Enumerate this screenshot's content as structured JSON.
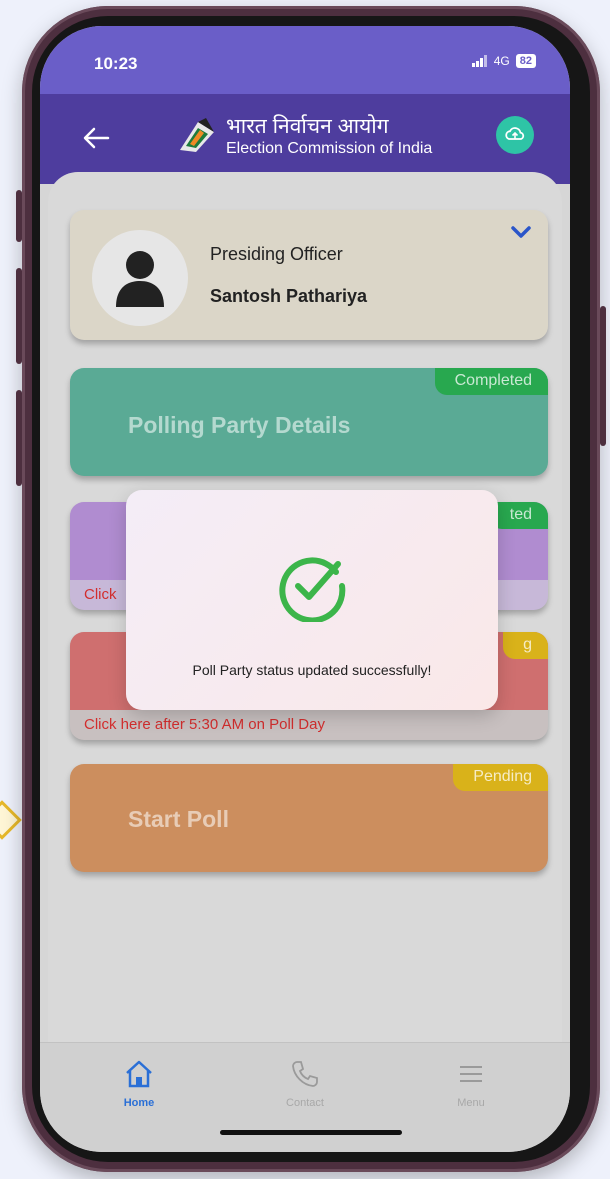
{
  "status_bar": {
    "time": "10:23",
    "network": "4G",
    "battery": "82"
  },
  "header": {
    "title_hindi": "भारत निर्वाचन आयोग",
    "title_english": "Election Commission of India"
  },
  "officer_card": {
    "role": "Presiding Officer",
    "name": "Santosh Pathariya"
  },
  "cards": {
    "polling_party": {
      "title": "Polling Party Details",
      "status": "Completed"
    },
    "second_card": {
      "hint_visible": "Click",
      "badge_visible": "ted"
    },
    "third_card": {
      "hint": "Click here after 5:30 AM on Poll Day",
      "badge_visible": "g"
    },
    "start_poll": {
      "title": "Start Poll",
      "status": "Pending"
    }
  },
  "dialog": {
    "message": "Poll Party status updated successfully!"
  },
  "bottom_nav": {
    "items": [
      {
        "label": "Home",
        "icon": "home-icon",
        "active": true
      },
      {
        "label": "Contact",
        "icon": "phone-icon",
        "active": false
      },
      {
        "label": "Menu",
        "icon": "menu-icon",
        "active": false
      }
    ]
  },
  "colors": {
    "status_bar": "#6a5ec8",
    "app_bar": "#4e3d9e",
    "completed": "#28a84f",
    "pending": "#d9b21a",
    "active_nav": "#2a6fd6",
    "success_icon": "#3cb54a"
  }
}
